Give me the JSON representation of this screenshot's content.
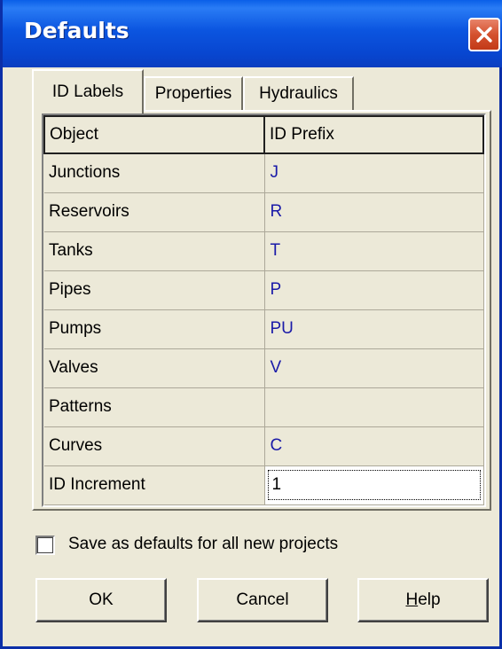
{
  "window": {
    "title": "Defaults"
  },
  "tabs": [
    {
      "label": "ID Labels",
      "active": true
    },
    {
      "label": "Properties",
      "active": false
    },
    {
      "label": "Hydraulics",
      "active": false
    }
  ],
  "grid": {
    "headers": [
      "Object",
      "ID Prefix"
    ],
    "rows": [
      {
        "object": "Junctions",
        "prefix": "J"
      },
      {
        "object": "Reservoirs",
        "prefix": "R"
      },
      {
        "object": "Tanks",
        "prefix": "T"
      },
      {
        "object": "Pipes",
        "prefix": "P"
      },
      {
        "object": "Pumps",
        "prefix": "PU"
      },
      {
        "object": "Valves",
        "prefix": "V"
      },
      {
        "object": "Patterns",
        "prefix": ""
      },
      {
        "object": "Curves",
        "prefix": "C"
      },
      {
        "object": "ID Increment",
        "prefix": "1"
      }
    ]
  },
  "save_defaults": {
    "label": "Save as defaults for all new projects",
    "checked": false
  },
  "buttons": {
    "ok": "OK",
    "cancel": "Cancel",
    "help_mnemonic": "H",
    "help_rest": "elp"
  },
  "colors": {
    "title_bar": "#0b55e0",
    "prefix_text": "#1a1aa8",
    "close_button": "#d4512e",
    "dialog_background": "#ece9d8"
  }
}
